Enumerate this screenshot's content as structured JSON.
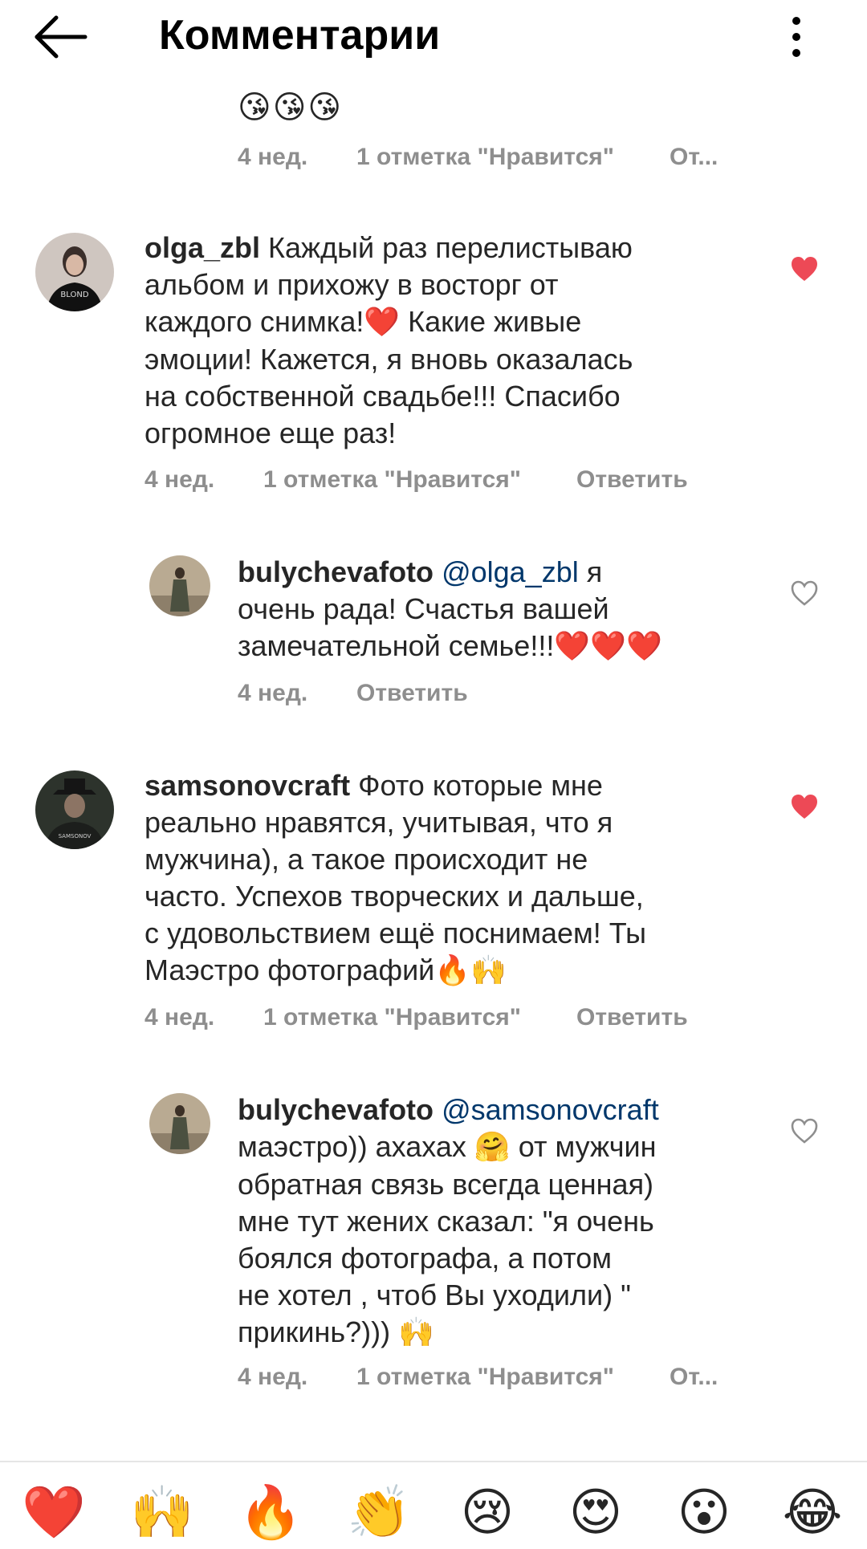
{
  "header": {
    "title": "Комментарии"
  },
  "top_fragment": {
    "emojis": "😘😘😘",
    "meta": {
      "time": "4 нед.",
      "likes": "1 отметка \"Нравится\"",
      "reply": "От..."
    }
  },
  "comments": [
    {
      "username": "olga_zbl",
      "lines": [
        "Каждый раз перелистываю",
        "альбом и прихожу в восторг от",
        "каждого снимка!",
        "эмоции! Кажется, я вновь оказалась",
        "на собственной свадьбе!!! Спасибо",
        "огромное еще раз!"
      ],
      "line3_tail": " Какие живые",
      "inline_emoji": "❤️",
      "time": "4 нед.",
      "likes": "1 отметка \"Нравится\"",
      "reply": "Ответить",
      "liked": true,
      "avatar_text": "BLOND"
    },
    {
      "username": "bulychevafoto",
      "mention": "@olga_zbl",
      "lines": [
        " я",
        "очень рада! Счастья вашей",
        "замечательной семье!!!"
      ],
      "trailing_emoji": "❤️❤️❤️",
      "time": "4 нед.",
      "reply": "Ответить",
      "liked": false
    },
    {
      "username": "samsonovcraft",
      "lines": [
        " Фото которые мне",
        "реально нравятся, учитывая, что я",
        "мужчина), а такое происходит не",
        "часто. Успехов творческих и дальше,",
        "с удовольствием ещё поснимаем! Ты",
        "Маэстро фотографий"
      ],
      "trailing_emoji": "🔥🙌",
      "time": "4 нед.",
      "likes": "1 отметка \"Нравится\"",
      "reply": "Ответить",
      "liked": true,
      "avatar_text": "SAMSONOV"
    },
    {
      "username": "bulychevafoto",
      "mention": "@samsonovcraft",
      "lines": [
        "маэстро)) ахахах",
        " от мужчин",
        "обратная связь всегда ценная)",
        "мне тут жених сказал: \"я очень",
        "боялся фотографа, а потом",
        "не хотел , чтоб Вы уходили) \"",
        "прикинь?)))"
      ],
      "hug_emoji": "🤗",
      "trailing_emoji": "🙌",
      "time": "4 нед.",
      "likes": "1 отметка \"Нравится\"",
      "reply": "От...",
      "liked": false
    }
  ],
  "quick_emojis": [
    {
      "name": "heart",
      "glyph": "❤️"
    },
    {
      "name": "raising-hands",
      "glyph": "🙌"
    },
    {
      "name": "fire",
      "glyph": "🔥"
    },
    {
      "name": "clapping-hands",
      "glyph": "👏"
    },
    {
      "name": "crying-face",
      "glyph": "😢"
    },
    {
      "name": "heart-eyes",
      "glyph": "😍"
    },
    {
      "name": "astonished-face",
      "glyph": "😮"
    },
    {
      "name": "tears-of-joy",
      "glyph": "😂"
    }
  ],
  "colors": {
    "like_red": "#ed4956",
    "meta_gray": "#8e8e8e",
    "mention_blue": "#00376b",
    "text": "#262626"
  }
}
